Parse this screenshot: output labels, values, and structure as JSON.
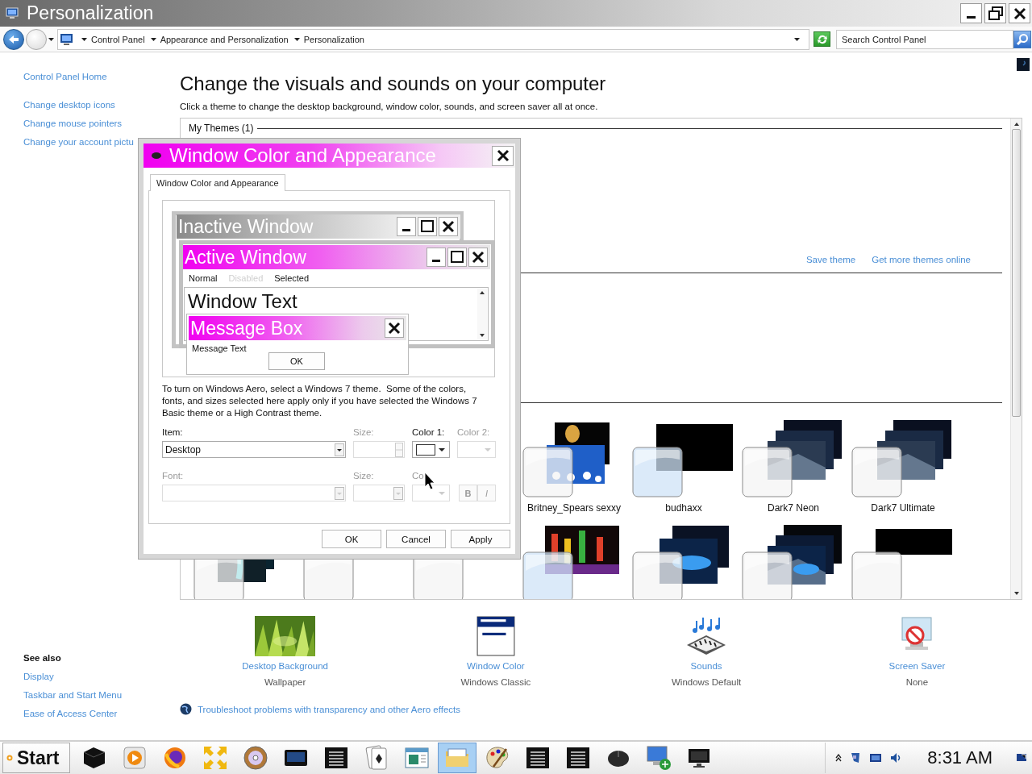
{
  "window": {
    "title": "Personalization"
  },
  "address_bar": {
    "breadcrumbs": [
      "Control Panel",
      "Appearance and Personalization",
      "Personalization"
    ],
    "search": {
      "placeholder": "Search Control Panel"
    }
  },
  "sidebar": {
    "links": [
      "Control Panel Home",
      "Change desktop icons",
      "Change mouse pointers",
      "Change your account pictu"
    ],
    "see_also": {
      "heading": "See also",
      "links": [
        "Display",
        "Taskbar and Start Menu",
        "Ease of Access Center"
      ]
    }
  },
  "content": {
    "heading": "Change the visuals and sounds on your computer",
    "description": "Click a theme to change the desktop background, window color, sounds, and screen saver all at once.",
    "themes": {
      "group": "My Themes (1)",
      "links": [
        "Save theme",
        "Get more themes online"
      ],
      "row_1": [
        {
          "label": "Britney_Spears sexxy"
        },
        {
          "label": "budhaxx"
        },
        {
          "label": "Dark7 Neon"
        },
        {
          "label": "Dark7 Ultimate"
        }
      ],
      "row_2": [
        {
          "kind": "picture"
        },
        {
          "kind": "picture"
        },
        {
          "kind": "picture"
        },
        {
          "kind": "picture"
        },
        {
          "kind": "picture"
        },
        {
          "kind": "picture"
        },
        {
          "kind": "picture"
        }
      ]
    },
    "settings": [
      {
        "kind": "wallpaper",
        "link": "Desktop Background",
        "value": "Wallpaper"
      },
      {
        "kind": "window",
        "link": "Window Color",
        "value": "Windows Classic"
      },
      {
        "kind": "sounds",
        "link": "Sounds",
        "value": "Windows Default"
      },
      {
        "kind": "screensaver",
        "link": "Screen Saver",
        "value": "None"
      }
    ],
    "troubleshoot_link": "Troubleshoot problems with transparency and other Aero effects"
  },
  "dialog": {
    "title": "Window Color and Appearance",
    "tab": {
      "label": "Window Color and Appearance",
      "selected": true
    },
    "preview": {
      "inactive_title": "Inactive Window",
      "active_title": "Active Window",
      "menu": [
        {
          "label": "Normal",
          "disabled": false
        },
        {
          "label": "Disabled",
          "disabled": true
        },
        {
          "label": "Selected",
          "disabled": false
        }
      ],
      "window_text": "Window Text",
      "message_title": "Message Box",
      "message_text": "Message Text",
      "message_button": "OK"
    },
    "note": "To turn on Windows Aero, select a Windows 7 theme.  Some of the colors, fonts, and sizes selected here apply only if you have selected the Windows 7 Basic theme or a High Contrast theme.",
    "fields": [
      {
        "kind": "dropdown",
        "label": "Item:",
        "value": "Desktop",
        "disabled": false
      },
      {
        "kind": "spinner",
        "label": "Size:",
        "disabled": true
      },
      {
        "kind": "color",
        "label": "Color 1:",
        "disabled": false
      },
      {
        "kind": "color",
        "label": "Color 2:",
        "disabled": true
      },
      {
        "kind": "dropdown",
        "label": "Font:",
        "disabled": true
      },
      {
        "kind": "dropdown",
        "label": "Size:",
        "disabled": true
      },
      {
        "kind": "color",
        "label": "Co",
        "disabled": true
      },
      {
        "kind": "toggles",
        "buttons": [
          {
            "label": "B",
            "disabled": true
          },
          {
            "label": "I",
            "disabled": true
          }
        ]
      }
    ],
    "buttons": [
      "OK",
      "Cancel",
      "Apply"
    ]
  },
  "taskbar": {
    "start": "Start",
    "buttons": [
      {
        "kind": "cube",
        "selected": false
      },
      {
        "kind": "media",
        "selected": false
      },
      {
        "kind": "browser",
        "selected": false
      },
      {
        "kind": "arrows",
        "selected": false
      },
      {
        "kind": "disc",
        "selected": false
      },
      {
        "kind": "screen",
        "selected": false
      },
      {
        "kind": "console",
        "selected": false
      },
      {
        "kind": "cards",
        "selected": false
      },
      {
        "kind": "window",
        "selected": false
      },
      {
        "kind": "folder",
        "selected": true
      },
      {
        "kind": "paint",
        "selected": false
      },
      {
        "kind": "console",
        "selected": false
      },
      {
        "kind": "console",
        "selected": false
      },
      {
        "kind": "mouse",
        "selected": false
      },
      {
        "kind": "network",
        "selected": false
      },
      {
        "kind": "monitor",
        "selected": false
      }
    ],
    "clock": "8:31 AM"
  }
}
